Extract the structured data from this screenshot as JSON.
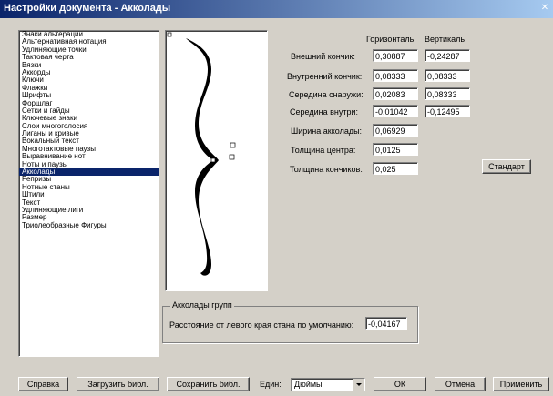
{
  "window": {
    "title": "Настройки документа - Акколады"
  },
  "categories": [
    "Знаки альтерации",
    "Альтернативная нотация",
    "Удлиняющие точки",
    "Тактовая черта",
    "Вязки",
    "Аккорды",
    "Ключи",
    "Флажки",
    "Шрифты",
    "Форшлаг",
    "Сетки и гайды",
    "Ключевые знаки",
    "Слои многоголосия",
    "Лиганы и кривые",
    "Вокальный текст",
    "Многотактовые паузы",
    "Выравнивание нот",
    "Ноты и паузы",
    "Акколады",
    "Репризы",
    "Нотные станы",
    "Штили",
    "Текст",
    "Удлиняющие лиги",
    "Размер",
    "Триолеобразные Фигуры"
  ],
  "selected_category": "Акколады",
  "columns": {
    "horizontal": "Горизонталь",
    "vertical": "Вертикаль"
  },
  "params": [
    {
      "label": "Внешний кончик:",
      "h": "0,30887",
      "v": "-0,24287"
    },
    {
      "label": "Внутренний кончик:",
      "h": "0,08333",
      "v": "0,08333"
    },
    {
      "label": "Середина снаружи:",
      "h": "0,02083",
      "v": "0,08333"
    },
    {
      "label": "Середина внутри:",
      "h": "-0,01042",
      "v": "-0,12495"
    },
    {
      "label": "Ширина акколады:",
      "h": "0,06929"
    },
    {
      "label": "Толщина центра:",
      "h": "0,0125"
    },
    {
      "label": "Толщина кончиков:",
      "h": "0,025"
    }
  ],
  "default_button": "Стандарт",
  "group": {
    "legend": "Акколады групп",
    "label": "Расстояние от левого края стана по умолчанию:",
    "value": "-0,04167"
  },
  "bottom": {
    "help": "Справка",
    "load": "Загрузить библ.",
    "save": "Сохранить библ.",
    "units_label": "Един:",
    "units_value": "Дюймы",
    "ok": "ОК",
    "cancel": "Отмена",
    "apply": "Применить"
  },
  "icons": {
    "close": "close-icon",
    "dropdown": "chevron-down-icon"
  }
}
